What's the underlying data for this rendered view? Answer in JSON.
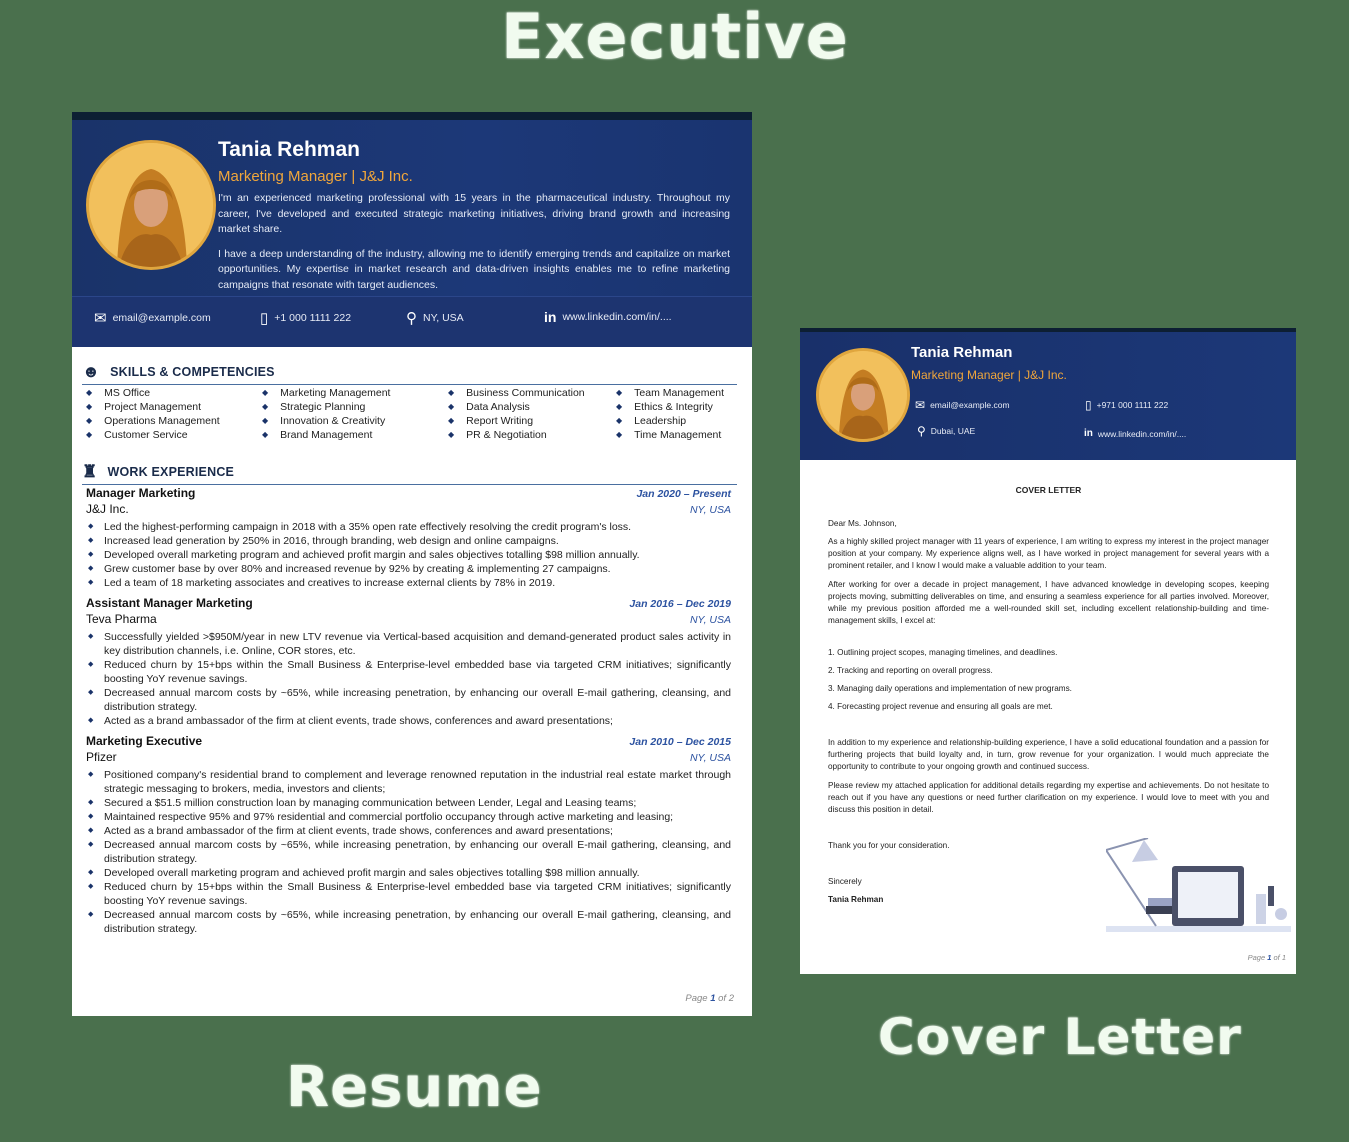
{
  "labels": {
    "executive": "Executive",
    "resume": "Resume",
    "cover_letter": "Cover Letter"
  },
  "colors": {
    "navy": "#1a3369",
    "accent": "#f0a63b",
    "date_blue": "#2c52a0",
    "background": "#4a704d"
  },
  "resume": {
    "name": "Tania Rehman",
    "role": "Marketing Manager | J&J Inc.",
    "summary": [
      "I'm an experienced marketing professional with 15 years in the pharmaceutical industry. Throughout my career, I've developed and executed strategic marketing initiatives, driving brand growth and increasing market share.",
      "I have a deep understanding of the industry, allowing me to identify emerging trends and capitalize on market opportunities. My expertise in market research and data-driven insights enables me to refine marketing campaigns that resonate with target audiences."
    ],
    "contact": {
      "email": "email@example.com",
      "phone": "+1 000 1111 222",
      "location": "NY, USA",
      "linkedin": "www.linkedin.com/in/...."
    },
    "skills_title": "SKILLS & COMPETENCIES",
    "skills": [
      [
        "MS Office",
        "Project Management",
        "Operations Management",
        "Customer Service"
      ],
      [
        "Marketing Management",
        "Strategic Planning",
        "Innovation & Creativity",
        "Brand Management"
      ],
      [
        "Business Communication",
        "Data Analysis",
        "Report Writing",
        "PR & Negotiation"
      ],
      [
        "Team Management",
        "Ethics & Integrity",
        "Leadership",
        "Time Management"
      ]
    ],
    "experience_title": "WORK EXPERIENCE",
    "jobs": [
      {
        "title": "Manager Marketing",
        "dates": "Jan 2020 – Present",
        "company": "J&J Inc.",
        "location": "NY, USA",
        "bullets": [
          "Led the highest-performing campaign in 2018 with a 35% open rate effectively resolving the credit program's loss.",
          "Increased lead generation by 250% in 2016, through branding, web design and online campaigns.",
          "Developed overall marketing program and achieved profit margin and sales objectives totalling $98 million annually.",
          "Grew customer base by over 80% and increased revenue by 92% by creating & implementing 27 campaigns.",
          "Led a team of 18 marketing associates and creatives to increase external clients by 78% in 2019."
        ]
      },
      {
        "title": "Assistant Manager Marketing",
        "dates": "Jan 2016 – Dec 2019",
        "company": "Teva Pharma",
        "location": "NY, USA",
        "bullets": [
          "Successfully yielded >$950M/year in new LTV revenue via Vertical-based acquisition and demand-generated product sales activity in key distribution channels, i.e. Online, COR stores, etc.",
          "Reduced churn by 15+bps within the Small Business & Enterprise-level embedded base via targeted CRM initiatives; significantly boosting YoY revenue savings.",
          "Decreased annual marcom costs by ~65%, while increasing penetration, by enhancing our overall E-mail gathering, cleansing, and distribution strategy.",
          "Acted as a brand ambassador of the firm at client events, trade shows, conferences and award presentations;"
        ]
      },
      {
        "title": "Marketing Executive",
        "dates": "Jan 2010 – Dec 2015",
        "company": "Pfizer",
        "location": "NY, USA",
        "bullets": [
          "Positioned company's residential brand to complement and leverage renowned reputation in the industrial real estate market through strategic messaging to brokers, media, investors and clients;",
          "Secured a $51.5 million construction loan by managing communication between Lender, Legal and Leasing teams;",
          "Maintained respective 95% and 97% residential and commercial portfolio occupancy through active marketing and leasing;",
          "Acted as a brand ambassador of the firm at client events, trade shows, conferences and award presentations;",
          "Decreased annual marcom costs by ~65%, while increasing penetration, by enhancing our overall E-mail gathering, cleansing, and distribution strategy.",
          "Developed overall marketing program and achieved profit margin and sales objectives totalling $98 million annually.",
          "Reduced churn by 15+bps within the Small Business & Enterprise-level embedded base via targeted CRM initiatives; significantly boosting YoY revenue savings.",
          "Decreased annual marcom costs by ~65%, while increasing penetration, by enhancing our overall E-mail gathering, cleansing, and distribution strategy."
        ]
      }
    ],
    "page": {
      "prefix": "Page ",
      "current": "1",
      "suffix": " of 2"
    }
  },
  "cover_letter": {
    "name": "Tania Rehman",
    "role": "Marketing Manager | J&J Inc.",
    "contact": {
      "email": "email@example.com",
      "phone": "+971 000 1111 222",
      "location": "Dubai, UAE",
      "linkedin": "www.linkedin.com/in/...."
    },
    "heading": "COVER LETTER",
    "salutation": "Dear Ms. Johnson,",
    "para1": "As a highly skilled project manager with 11 years of experience, I am writing to express my interest in the project manager position at your company. My experience aligns well, as I have worked in project management for several years with a prominent retailer, and I know I would make a valuable addition to your team.",
    "para2": "After working for over a decade in project management, I have advanced knowledge in developing scopes, keeping projects moving, submitting deliverables on time, and ensuring a seamless experience for all parties involved. Moreover, while my previous position afforded me a well-rounded skill set, including excellent relationship-building and time-management skills, I excel at:",
    "list": [
      "1. Outlining project scopes, managing timelines, and deadlines.",
      "2. Tracking and reporting on overall progress.",
      "3. Managing daily operations and implementation of new programs.",
      "4. Forecasting project revenue and ensuring all goals are met."
    ],
    "para3": "In addition to my experience and relationship-building experience, I have a solid educational foundation and a passion for furthering projects that build loyalty and, in turn, grow revenue for your organization. I would much appreciate the opportunity to contribute to your ongoing growth and continued success.",
    "para4": "Please review my attached application for additional details regarding my expertise and achievements. Do not hesitate to reach out if you have any questions or need further clarification on my experience. I would love to meet with you and discuss this position in detail.",
    "thanks": "Thank you for your consideration.",
    "closing": "Sincerely",
    "signature": "Tania Rehman",
    "page": {
      "prefix": "Page ",
      "current": "1",
      "suffix": " of 1"
    }
  },
  "icons": [
    "mail-icon",
    "phone-icon",
    "location-pin-icon",
    "linkedin-icon",
    "head-gear-icon",
    "meeting-table-icon",
    "desk-illustration"
  ]
}
